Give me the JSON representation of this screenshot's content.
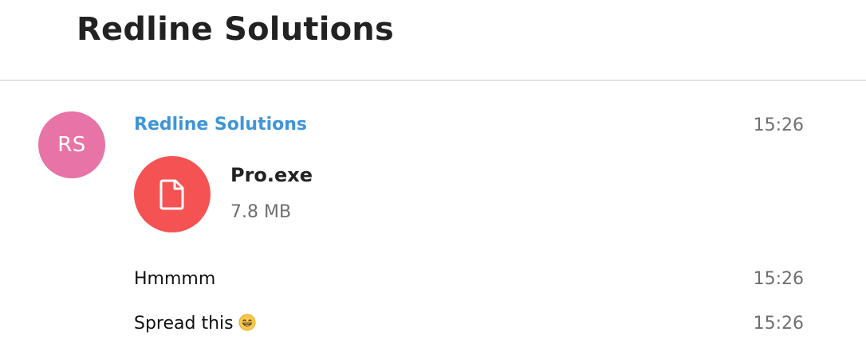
{
  "header": {
    "title": "Redline Solutions"
  },
  "message_group": {
    "avatar_initials": "RS",
    "avatar_color": "#e873a6",
    "sender_name": "Redline Solutions",
    "sender_color": "#3f95d6",
    "file_message": {
      "time": "15:26",
      "icon": "document-icon",
      "icon_color": "#f55353",
      "file_name": "Pro.exe",
      "file_size": "7.8 MB"
    },
    "messages": [
      {
        "text": "Hmmmm",
        "time": "15:26"
      },
      {
        "text": "Spread this",
        "emoji": "grinning-face-with-smiling-eyes",
        "time": "15:26"
      }
    ]
  }
}
